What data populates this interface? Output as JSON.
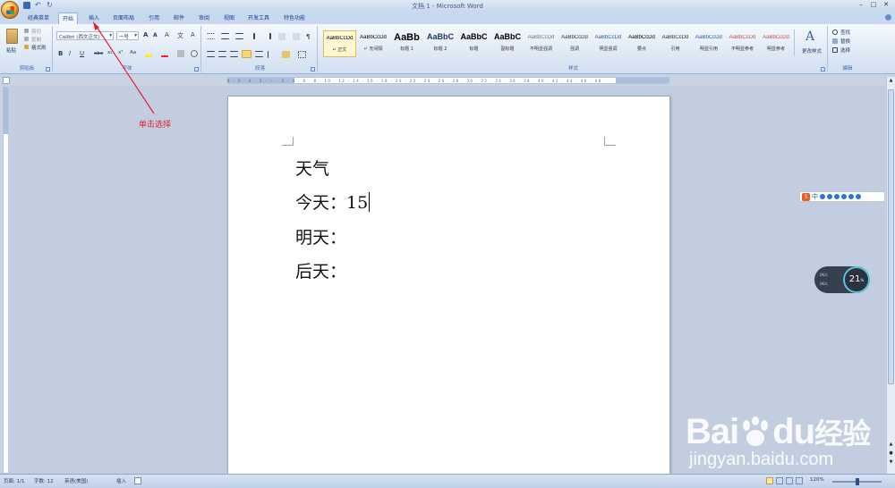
{
  "window": {
    "title": "文档 1 - Microsoft Word",
    "controls": [
      "–",
      "□",
      "✕"
    ]
  },
  "tabs": [
    "经典菜单",
    "开始",
    "插入",
    "页面布局",
    "引用",
    "邮件",
    "审阅",
    "视图",
    "开发工具",
    "特色功能"
  ],
  "active_tab": "开始",
  "ribbon": {
    "clipboard": {
      "label": "剪贴板",
      "paste": "粘贴",
      "cut": "剪切",
      "copy": "复制",
      "format_painter": "格式刷"
    },
    "font": {
      "label": "字体",
      "font_name": "Calibri (西文正文)",
      "font_size": "一号",
      "bold": "B",
      "italic": "I",
      "underline": "U",
      "strike": "abe",
      "subscript": "x₂",
      "superscript": "x²",
      "change_case": "Aa",
      "grow": "A",
      "shrink": "A",
      "wen": "文",
      "clear": "A"
    },
    "paragraph": {
      "label": "段落"
    },
    "styles": {
      "label": "样式",
      "items": [
        {
          "preview": "AaBbCcDd",
          "name": "↵ 正文"
        },
        {
          "preview": "AaBbCcDd",
          "name": "↵ 无间隔"
        },
        {
          "preview": "AaBb",
          "name": "标题 1"
        },
        {
          "preview": "AaBbC",
          "name": "标题 2"
        },
        {
          "preview": "AaBbC",
          "name": "标题"
        },
        {
          "preview": "AaBbC",
          "name": "副标题"
        },
        {
          "preview": "AaBbCcDd",
          "name": "不明显强调"
        },
        {
          "preview": "AaBbCcDd",
          "name": "强调"
        },
        {
          "preview": "AaBbCcDd",
          "name": "明显强调"
        },
        {
          "preview": "AaBbCcDd",
          "name": "要点"
        },
        {
          "preview": "AaBbCcDd",
          "name": "引用"
        },
        {
          "preview": "AaBbCcDd",
          "name": "明显引用"
        },
        {
          "preview": "AaBbCcDd",
          "name": "不明显参考"
        },
        {
          "preview": "AaBbCcDd",
          "name": "明显参考"
        }
      ],
      "change_styles": "更改样式"
    },
    "editing": {
      "label": "编辑",
      "find": "查找",
      "replace": "替换",
      "select": "选择"
    }
  },
  "ruler": {
    "marks": "8 · 6 · 4 · 2 · ⌐ · 2 · 4 · 6 · 8 · 10 · 12 · 14 · 16 · 18 · 20 · 22 · 24 · 26 · 28 · 30 · 32 · 34 · 36 · 38 · 40 · 42 · 44 · 46 · 48"
  },
  "document": {
    "lines": [
      "天气",
      "今天：15",
      "明天：",
      "后天："
    ]
  },
  "annotation": {
    "text": "单击选择"
  },
  "ime": {
    "logo": "S",
    "mode": "中"
  },
  "speed_widget": {
    "value": "21",
    "unit": "%",
    "up": "0K/s",
    "down": "0K/s"
  },
  "status_bar": {
    "page": "页面: 1/1",
    "words": "字数: 12",
    "language": "英语(美国)",
    "insert": "插入",
    "zoom": "120%"
  },
  "watermark": {
    "logo_left": "Bai",
    "logo_right": "du",
    "logo_cn": "经验",
    "url": "jingyan.baidu.com"
  },
  "colors": {
    "annotation": "#e2202c",
    "accent": "#15428b",
    "ime_logo": "#ef5a24"
  }
}
